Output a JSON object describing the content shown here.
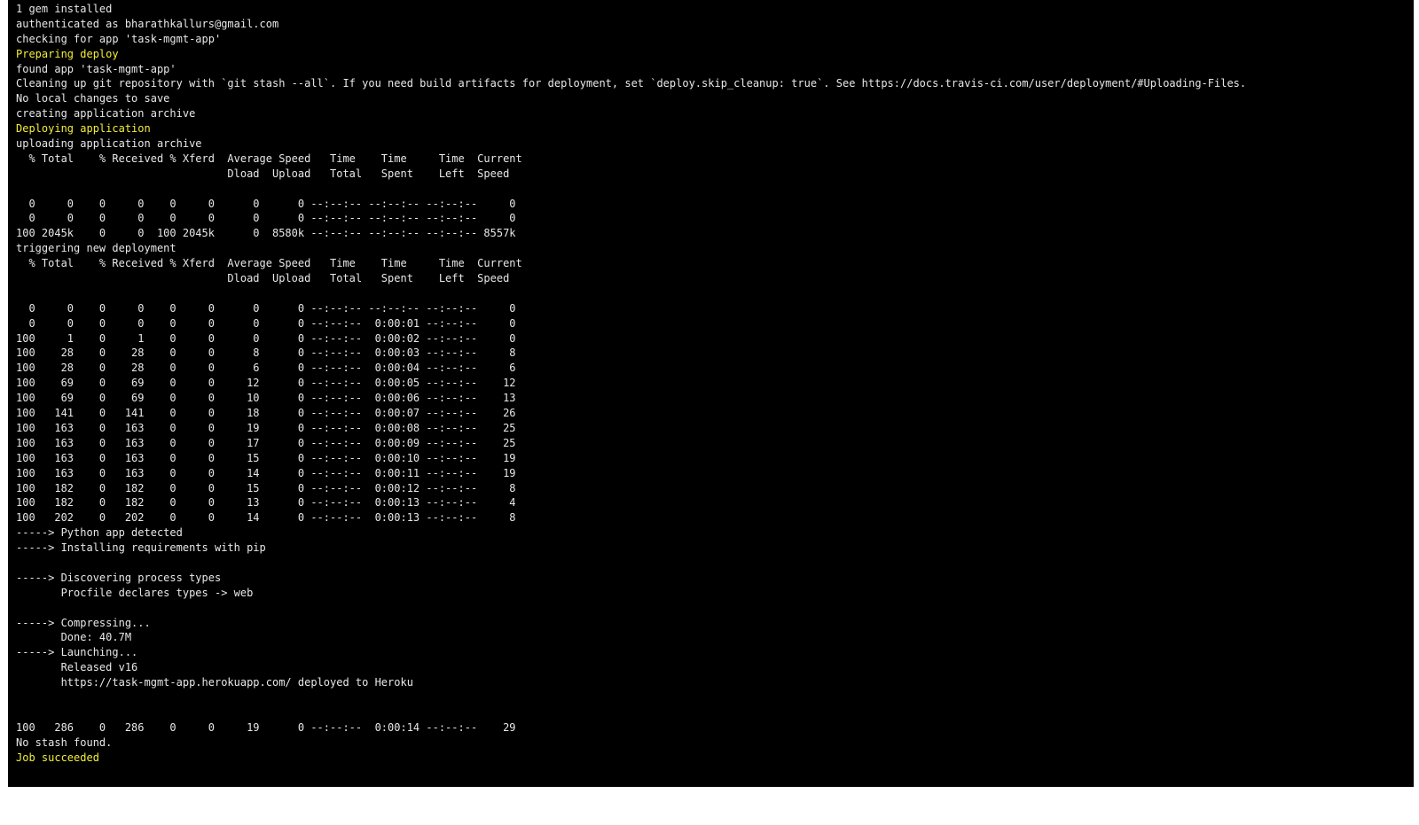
{
  "terminal": {
    "default_color": "#e8e8e8",
    "highlight_color": "#f2ee3b",
    "background_color": "#000000",
    "lines": [
      {
        "text": "1 gem installed",
        "highlight": false
      },
      {
        "text": "authenticated as bharathkallurs@gmail.com",
        "highlight": false
      },
      {
        "text": "checking for app 'task-mgmt-app'",
        "highlight": false
      },
      {
        "text": "Preparing deploy",
        "highlight": true
      },
      {
        "text": "found app 'task-mgmt-app'",
        "highlight": false
      },
      {
        "text": "Cleaning up git repository with `git stash --all`. If you need build artifacts for deployment, set `deploy.skip_cleanup: true`. See https://docs.travis-ci.com/user/deployment/#Uploading-Files.",
        "highlight": false
      },
      {
        "text": "No local changes to save",
        "highlight": false
      },
      {
        "text": "creating application archive",
        "highlight": false
      },
      {
        "text": "Deploying application",
        "highlight": true
      },
      {
        "text": "uploading application archive",
        "highlight": false
      },
      {
        "text": "  % Total    % Received % Xferd  Average Speed   Time    Time     Time  Current",
        "highlight": false
      },
      {
        "text": "                                 Dload  Upload   Total   Spent    Left  Speed",
        "highlight": false
      },
      {
        "text": "",
        "highlight": false
      },
      {
        "text": "  0     0    0     0    0     0      0      0 --:--:-- --:--:-- --:--:--     0",
        "highlight": false
      },
      {
        "text": "  0     0    0     0    0     0      0      0 --:--:-- --:--:-- --:--:--     0",
        "highlight": false
      },
      {
        "text": "100 2045k    0     0  100 2045k      0  8580k --:--:-- --:--:-- --:--:-- 8557k",
        "highlight": false
      },
      {
        "text": "triggering new deployment",
        "highlight": false
      },
      {
        "text": "  % Total    % Received % Xferd  Average Speed   Time    Time     Time  Current",
        "highlight": false
      },
      {
        "text": "                                 Dload  Upload   Total   Spent    Left  Speed",
        "highlight": false
      },
      {
        "text": "",
        "highlight": false
      },
      {
        "text": "  0     0    0     0    0     0      0      0 --:--:-- --:--:-- --:--:--     0",
        "highlight": false
      },
      {
        "text": "  0     0    0     0    0     0      0      0 --:--:--  0:00:01 --:--:--     0",
        "highlight": false
      },
      {
        "text": "100     1    0     1    0     0      0      0 --:--:--  0:00:02 --:--:--     0",
        "highlight": false
      },
      {
        "text": "100    28    0    28    0     0      8      0 --:--:--  0:00:03 --:--:--     8",
        "highlight": false
      },
      {
        "text": "100    28    0    28    0     0      6      0 --:--:--  0:00:04 --:--:--     6",
        "highlight": false
      },
      {
        "text": "100    69    0    69    0     0     12      0 --:--:--  0:00:05 --:--:--    12",
        "highlight": false
      },
      {
        "text": "100    69    0    69    0     0     10      0 --:--:--  0:00:06 --:--:--    13",
        "highlight": false
      },
      {
        "text": "100   141    0   141    0     0     18      0 --:--:--  0:00:07 --:--:--    26",
        "highlight": false
      },
      {
        "text": "100   163    0   163    0     0     19      0 --:--:--  0:00:08 --:--:--    25",
        "highlight": false
      },
      {
        "text": "100   163    0   163    0     0     17      0 --:--:--  0:00:09 --:--:--    25",
        "highlight": false
      },
      {
        "text": "100   163    0   163    0     0     15      0 --:--:--  0:00:10 --:--:--    19",
        "highlight": false
      },
      {
        "text": "100   163    0   163    0     0     14      0 --:--:--  0:00:11 --:--:--    19",
        "highlight": false
      },
      {
        "text": "100   182    0   182    0     0     15      0 --:--:--  0:00:12 --:--:--     8",
        "highlight": false
      },
      {
        "text": "100   182    0   182    0     0     13      0 --:--:--  0:00:13 --:--:--     4",
        "highlight": false
      },
      {
        "text": "100   202    0   202    0     0     14      0 --:--:--  0:00:13 --:--:--     8",
        "highlight": false
      },
      {
        "text": "-----> Python app detected",
        "highlight": false
      },
      {
        "text": "-----> Installing requirements with pip",
        "highlight": false
      },
      {
        "text": "",
        "highlight": false
      },
      {
        "text": "-----> Discovering process types",
        "highlight": false
      },
      {
        "text": "       Procfile declares types -> web",
        "highlight": false
      },
      {
        "text": "",
        "highlight": false
      },
      {
        "text": "-----> Compressing...",
        "highlight": false
      },
      {
        "text": "       Done: 40.7M",
        "highlight": false
      },
      {
        "text": "-----> Launching...",
        "highlight": false
      },
      {
        "text": "       Released v16",
        "highlight": false
      },
      {
        "text": "       https://task-mgmt-app.herokuapp.com/ deployed to Heroku",
        "highlight": false
      },
      {
        "text": "",
        "highlight": false
      },
      {
        "text": "",
        "highlight": false
      },
      {
        "text": "100   286    0   286    0     0     19      0 --:--:--  0:00:14 --:--:--    29",
        "highlight": false
      },
      {
        "text": "No stash found.",
        "highlight": false
      },
      {
        "text": "Job succeeded",
        "highlight": true
      }
    ]
  }
}
